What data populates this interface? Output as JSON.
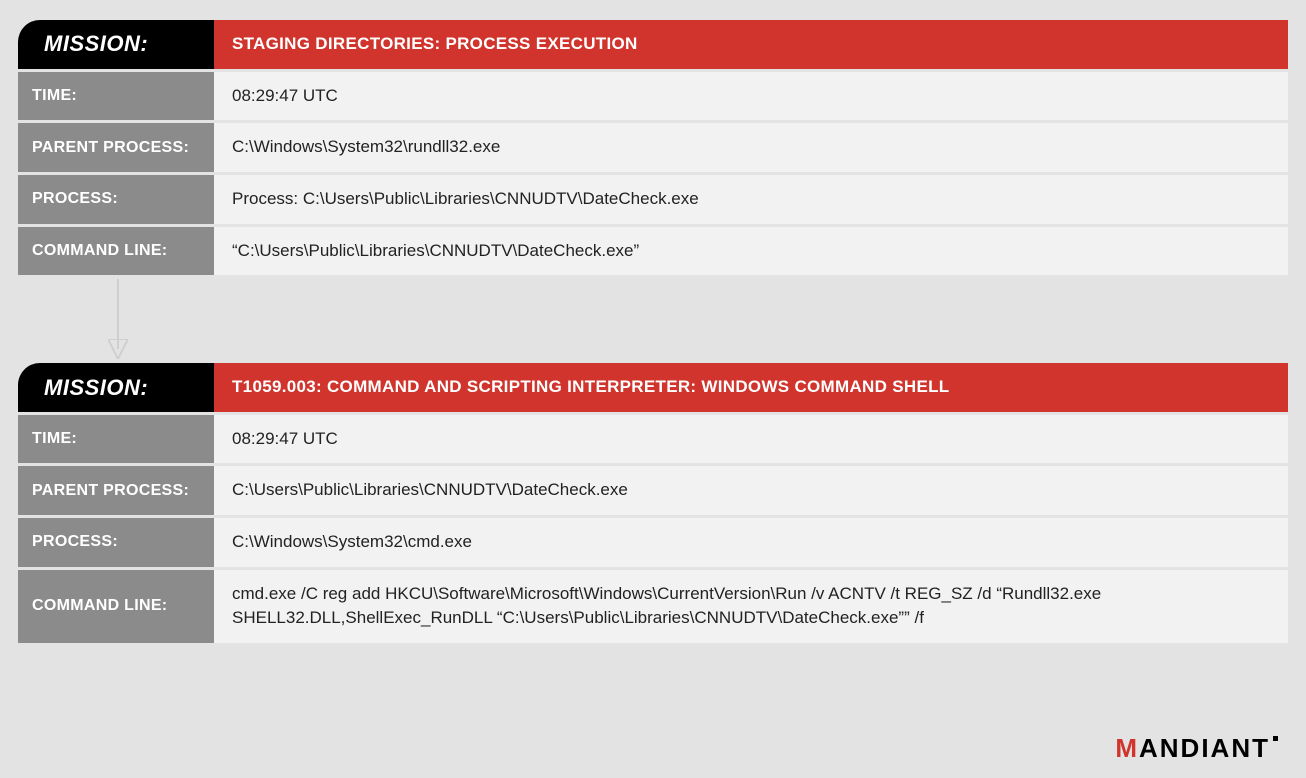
{
  "cards": [
    {
      "mission_label": "MISSION:",
      "mission_value": "STAGING DIRECTORIES: PROCESS EXECUTION",
      "rows": [
        {
          "label": "TIME:",
          "value": "08:29:47 UTC"
        },
        {
          "label": "PARENT PROCESS:",
          "value": "C:\\Windows\\System32\\rundll32.exe"
        },
        {
          "label": "PROCESS:",
          "value": "Process: C:\\Users\\Public\\Libraries\\CNNUDTV\\DateCheck.exe"
        },
        {
          "label": "COMMAND LINE:",
          "value": "“C:\\Users\\Public\\Libraries\\CNNUDTV\\DateCheck.exe”"
        }
      ]
    },
    {
      "mission_label": "MISSION:",
      "mission_value": "T1059.003: COMMAND AND SCRIPTING INTERPRETER: WINDOWS COMMAND SHELL",
      "rows": [
        {
          "label": "TIME:",
          "value": "08:29:47 UTC"
        },
        {
          "label": "PARENT PROCESS:",
          "value": "C:\\Users\\Public\\Libraries\\CNNUDTV\\DateCheck.exe"
        },
        {
          "label": "PROCESS:",
          "value": "C:\\Windows\\System32\\cmd.exe"
        },
        {
          "label": "COMMAND LINE:",
          "value": "cmd.exe /C reg add HKCU\\Software\\Microsoft\\Windows\\CurrentVersion\\Run /v ACNTV /t REG_SZ /d “Rundll32.exe SHELL32.DLL,ShellExec_RunDLL “C:\\Users\\Public\\Libraries\\CNNUDTV\\DateCheck.exe”” /f"
        }
      ]
    }
  ],
  "brand": "MANDIANT"
}
